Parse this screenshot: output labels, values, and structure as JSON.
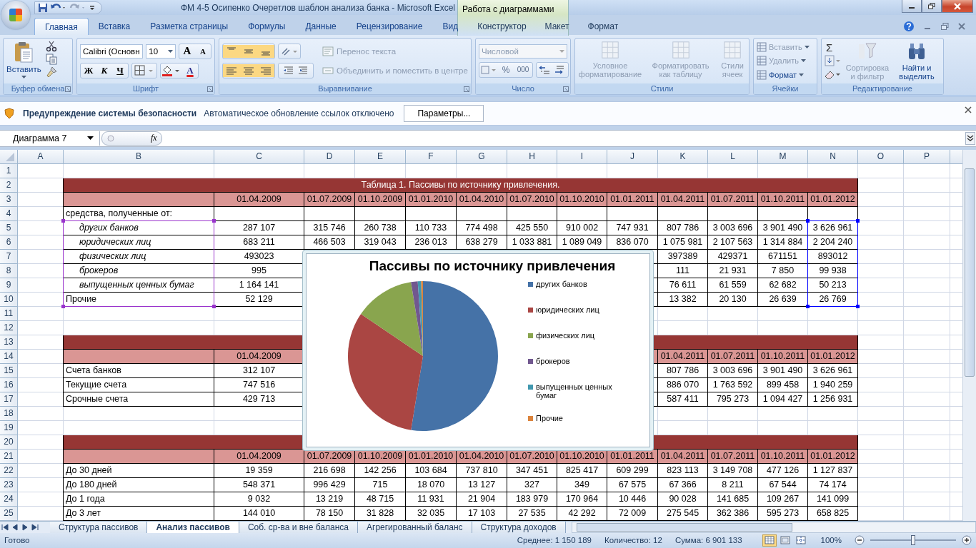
{
  "title_bar": {
    "title": "ФМ 4-5 Осипенко Очеретлов шаблон анализа банка - Microsoft Excel",
    "context_group": "Работа с диаграммами"
  },
  "ribbon_tabs": [
    {
      "label": "Главная",
      "selected": true,
      "contextual": false
    },
    {
      "label": "Вставка",
      "selected": false,
      "contextual": false
    },
    {
      "label": "Разметка страницы",
      "selected": false,
      "contextual": false
    },
    {
      "label": "Формулы",
      "selected": false,
      "contextual": false
    },
    {
      "label": "Данные",
      "selected": false,
      "contextual": false
    },
    {
      "label": "Рецензирование",
      "selected": false,
      "contextual": false
    },
    {
      "label": "Вид",
      "selected": false,
      "contextual": false
    },
    {
      "label": "Конструктор",
      "selected": false,
      "contextual": true
    },
    {
      "label": "Макет",
      "selected": false,
      "contextual": true
    },
    {
      "label": "Формат",
      "selected": false,
      "contextual": true
    }
  ],
  "ribbon": {
    "clipboard": {
      "label": "Буфер обмена",
      "paste": "Вставить"
    },
    "font": {
      "label": "Шрифт",
      "font": "Calibri (Основн",
      "size": "10",
      "grow": "A",
      "shrink": "A",
      "bold": "Ж",
      "italic": "К",
      "underline": "Ч",
      "font_color": "A"
    },
    "alignment": {
      "label": "Выравнивание",
      "wrap": {
        "label": "Перенос текста",
        "disabled": true
      },
      "merge": {
        "label": "Объединить и поместить в центре",
        "disabled": true
      }
    },
    "number": {
      "label": "Число",
      "format": {
        "label": "Числовой",
        "disabled": true
      },
      "percent": "%",
      "thousands": "000"
    },
    "styles": {
      "label": "Стили",
      "buttons": [
        {
          "label": "Условное форматирование",
          "disabled": true
        },
        {
          "label": "Форматировать как таблицу",
          "disabled": true
        },
        {
          "label": "Стили ячеек",
          "disabled": true
        }
      ]
    },
    "cells": {
      "label": "Ячейки",
      "buttons": [
        {
          "label": "Вставить",
          "disabled": true
        },
        {
          "label": "Удалить",
          "disabled": true
        },
        {
          "label": "Формат",
          "disabled": false
        }
      ]
    },
    "editing": {
      "label": "Редактирование",
      "sum": "Σ",
      "buttons": [
        {
          "label": "Сортировка и фильтр",
          "disabled": true
        },
        {
          "label": "Найти и выделить",
          "disabled": false
        }
      ]
    }
  },
  "security_bar": {
    "title": "Предупреждение системы безопасности",
    "message": "Автоматическое обновление ссылок отключено",
    "button": "Параметры..."
  },
  "formula_bar": {
    "name_box": "Диаграмма 7",
    "fx": "fx"
  },
  "sheet": {
    "columns": [
      "A",
      "B",
      "C",
      "D",
      "E",
      "F",
      "G",
      "H",
      "I",
      "J",
      "K",
      "L",
      "M",
      "N",
      "O",
      "P"
    ],
    "rows": [
      {
        "number": "1",
        "kind": "blank"
      },
      {
        "number": "2",
        "kind": "title",
        "text": "Таблица 1. Пассивы по источнику привлечения."
      },
      {
        "number": "3",
        "kind": "header",
        "cells": {
          "C": "01.04.2009",
          "D": "01.07.2009",
          "E": "01.10.2009",
          "F": "01.01.2010",
          "G": "01.04.2010",
          "H": "01.07.2010",
          "I": "01.10.2010",
          "J": "01.01.2011",
          "K": "01.04.2011",
          "L": "01.07.2011",
          "M": "01.10.2011",
          "N": "01.01.2012"
        }
      },
      {
        "number": "4",
        "kind": "group",
        "cells": {
          "B": "средства, полученные от:"
        }
      },
      {
        "number": "5",
        "kind": "item",
        "cells": {
          "B": "других банков",
          "C": "287 107",
          "D": "315 746",
          "E": "260 738",
          "F": "110 733",
          "G": "774 498",
          "H": "425 550",
          "I": "910 002",
          "J": "747 931",
          "K": "807 786",
          "L": "3 003 696",
          "M": "3 901 490",
          "N": "3 626 961"
        }
      },
      {
        "number": "6",
        "kind": "item",
        "cells": {
          "B": "юридических лиц",
          "C": "683 211",
          "D": "466 503",
          "E": "319 043",
          "F": "236 013",
          "G": "638 279",
          "H": "1 033 881",
          "I": "1 089 049",
          "J": "836 070",
          "K": "1 075 981",
          "L": "2 107 563",
          "M": "1 314 884",
          "N": "2 204 240"
        }
      },
      {
        "number": "7",
        "kind": "item",
        "cells": {
          "B": "физических лиц",
          "C": "493023",
          "K": "397389",
          "L": "429371",
          "M": "671151",
          "N": "893012"
        }
      },
      {
        "number": "8",
        "kind": "item",
        "cells": {
          "B": "брокеров",
          "C": "995",
          "K": "111",
          "L": "21 931",
          "M": "7 850",
          "N": "99 938"
        }
      },
      {
        "number": "9",
        "kind": "item",
        "cells": {
          "B": "выпущенных ценных бумаг",
          "C": "1 164 141",
          "K": "76 611",
          "L": "61 559",
          "M": "62 682",
          "N": "50 213"
        }
      },
      {
        "number": "10",
        "kind": "data",
        "cells": {
          "B": "Прочие",
          "C": "52 129",
          "K": "13 382",
          "L": "20 130",
          "M": "26 639",
          "N": "26 769"
        }
      },
      {
        "number": "11",
        "kind": "blank"
      },
      {
        "number": "12",
        "kind": "blank"
      },
      {
        "number": "13",
        "kind": "band"
      },
      {
        "number": "14",
        "kind": "header",
        "cells": {
          "C": "01.04.2009",
          "K": "01.04.2011",
          "L": "01.07.2011",
          "M": "01.10.2011",
          "N": "01.01.2012"
        }
      },
      {
        "number": "15",
        "kind": "data",
        "cells": {
          "B": "Счета банков",
          "C": "312 107",
          "K": "807 786",
          "L": "3 003 696",
          "M": "3 901 490",
          "N": "3 626 961"
        }
      },
      {
        "number": "16",
        "kind": "data",
        "cells": {
          "B": "Текущие счета",
          "C": "747 516",
          "K": "886 070",
          "L": "1 763 592",
          "M": "899 458",
          "N": "1 940 259"
        }
      },
      {
        "number": "17",
        "kind": "data",
        "cells": {
          "B": "Срочные счета",
          "C": "429 713",
          "K": "587 411",
          "L": "795 273",
          "M": "1 094 427",
          "N": "1 256 931"
        }
      },
      {
        "number": "18",
        "kind": "blank"
      },
      {
        "number": "19",
        "kind": "blank"
      },
      {
        "number": "20",
        "kind": "band"
      },
      {
        "number": "21",
        "kind": "header",
        "cells": {
          "C": "01.04.2009",
          "D": "01.07.2009",
          "E": "01.10.2009",
          "F": "01.01.2010",
          "G": "01.04.2010",
          "H": "01.07.2010",
          "I": "01.10.2010",
          "J": "01.01.2011",
          "K": "01.04.2011",
          "L": "01.07.2011",
          "M": "01.10.2011",
          "N": "01.01.2012"
        }
      },
      {
        "number": "22",
        "kind": "data",
        "cells": {
          "B": "До 30 дней",
          "C": "19 359",
          "D": "216 698",
          "E": "142 256",
          "F": "103 684",
          "G": "737 810",
          "H": "347 451",
          "I": "825 417",
          "J": "609 299",
          "K": "823 113",
          "L": "3 149 708",
          "M": "477 126",
          "N": "1 127 837"
        }
      },
      {
        "number": "23",
        "kind": "data",
        "cells": {
          "B": "До 180 дней",
          "C": "548 371",
          "D": "996 429",
          "E": "715",
          "F": "18 070",
          "G": "13 127",
          "H": "327",
          "I": "349",
          "J": "67 575",
          "K": "67 366",
          "L": "8 211",
          "M": "67 544",
          "N": "74 174"
        }
      },
      {
        "number": "24",
        "kind": "data",
        "cells": {
          "B": "До 1 года",
          "C": "9 032",
          "D": "13 219",
          "E": "48 715",
          "F": "11 931",
          "G": "21 904",
          "H": "183 979",
          "I": "170 964",
          "J": "10 446",
          "K": "90 028",
          "L": "141 685",
          "M": "109 267",
          "N": "141 099"
        }
      },
      {
        "number": "25",
        "kind": "data",
        "cells": {
          "B": "До 3 лет",
          "C": "144 010",
          "D": "78 150",
          "E": "31 828",
          "F": "32 035",
          "G": "17 103",
          "H": "27 535",
          "I": "42 292",
          "J": "72 009",
          "K": "275 545",
          "L": "362 386",
          "M": "595 273",
          "N": "658 825"
        }
      }
    ],
    "chart_ranges": [
      {
        "kind": "labels",
        "color": "#9933cc"
      },
      {
        "kind": "values",
        "color": "#0000ff"
      }
    ]
  },
  "chart": {
    "chart_data": {
      "type": "pie",
      "title": "Пассивы по источнику привлечения",
      "categories": [
        "других банков",
        "юридических лиц",
        "физических лиц",
        "брокеров",
        "выпущенных ценных бумаг",
        "Прочие"
      ],
      "values": [
        52.55,
        31.94,
        12.94,
        1.45,
        0.73,
        0.39
      ],
      "colors": [
        "#4572a7",
        "#aa4643",
        "#89a54e",
        "#71588f",
        "#4198af",
        "#db843d"
      ]
    }
  },
  "sheet_tabs": [
    {
      "label": "Структура пассивов",
      "selected": false
    },
    {
      "label": "Анализ пассивов",
      "selected": true
    },
    {
      "label": "Соб. ср-ва и вне баланса",
      "selected": false
    },
    {
      "label": "Агрегированный баланс",
      "selected": false
    },
    {
      "label": "Структура доходов",
      "selected": false
    }
  ],
  "status_bar": {
    "ready": "Готово",
    "average": "Среднее: 1 150 189",
    "count": "Количество: 12",
    "sum": "Сумма: 6 901 133",
    "views": [
      {
        "kind": "normal",
        "selected": true
      },
      {
        "kind": "layout",
        "selected": false
      },
      {
        "kind": "pagebreak",
        "selected": false
      }
    ],
    "zoom": "100%",
    "zoom_slider": {
      "level": 0.5
    }
  }
}
